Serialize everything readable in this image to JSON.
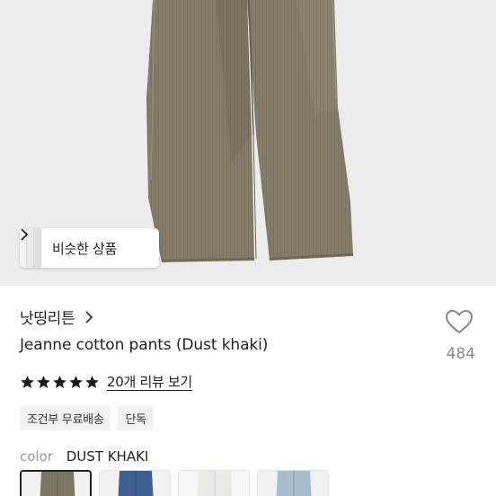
{
  "similar_button": {
    "label": "비슷한 상품"
  },
  "shop": {
    "name": "낫띵리튼"
  },
  "product": {
    "title": "Jeanne cotton pants (Dust khaki)"
  },
  "like": {
    "count": "484"
  },
  "rating": {
    "stars": 5,
    "review_link": "20개 리뷰 보기"
  },
  "tags": [
    "조건부 무료배송",
    "단독"
  ],
  "color_option": {
    "label": "color",
    "value": "DUST KHAKI"
  },
  "swatches": [
    {
      "name": "dust-khaki",
      "color": "#7b7563",
      "selected": true
    },
    {
      "name": "blue",
      "color": "#3f5f93",
      "selected": false
    },
    {
      "name": "white",
      "color": "#e9e9e6",
      "selected": false
    },
    {
      "name": "light-blue",
      "color": "#a7bccd",
      "selected": false
    }
  ],
  "colors": {
    "pants": "#837c68",
    "background": "#ececec",
    "star": "#1a1a1a"
  }
}
